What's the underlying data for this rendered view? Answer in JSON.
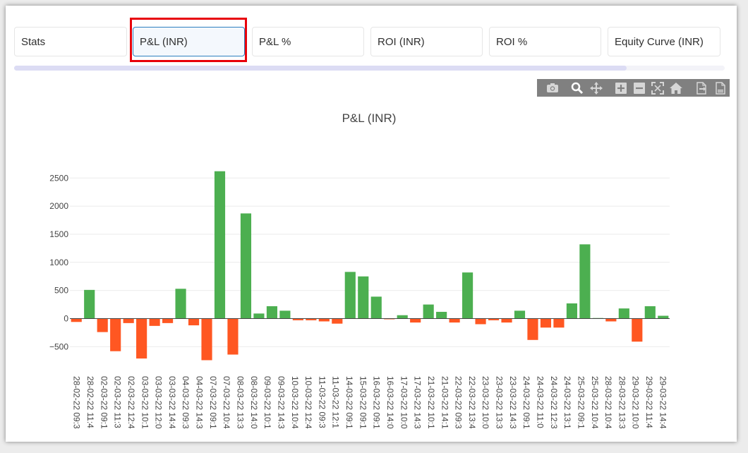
{
  "tabs": [
    {
      "label": "Stats",
      "active": false
    },
    {
      "label": "P&L (INR)",
      "active": true
    },
    {
      "label": "P&L %",
      "active": false
    },
    {
      "label": "ROI (INR)",
      "active": false
    },
    {
      "label": "ROI %",
      "active": false
    },
    {
      "label": "Equity Curve (INR)",
      "active": false
    }
  ],
  "modebar_icons": [
    "camera-icon",
    "zoom-icon",
    "pan-icon",
    "zoom-in-icon",
    "zoom-out-icon",
    "autoscale-icon",
    "home-icon",
    "download-csv-icon",
    "download-file-icon"
  ],
  "colors": {
    "positive": "#4caf50",
    "negative": "#ff5722",
    "active_tab_border": "#2d7fbf",
    "highlight": "#e8000b"
  },
  "chart_data": {
    "type": "bar",
    "title": "P&L (INR)",
    "xlabel": "",
    "ylabel": "",
    "ylim": [
      -750,
      2700
    ],
    "y_ticks": [
      2500,
      2000,
      1500,
      1000,
      500,
      0,
      -500
    ],
    "grid": true,
    "categories": [
      "28-02-22 09:3",
      "28-02-22 11:4",
      "02-03-22 09:1",
      "02-03-22 11:3",
      "02-03-22 12:4",
      "03-03-22 10:1",
      "03-03-22 12:0",
      "03-03-22 14:4",
      "04-03-22 09:3",
      "04-03-22 14:3",
      "07-03-22 09:1",
      "07-03-22 10:4",
      "08-03-22 13:3",
      "08-03-22 14:0",
      "09-03-22 10:1",
      "09-03-22 14:3",
      "10-03-22 10:4",
      "10-03-22 12:4",
      "11-03-22 09:3",
      "11-03-22 12:1",
      "14-03-22 09:1",
      "15-03-22 09:1",
      "16-03-22 09:1",
      "16-03-22 14:0",
      "17-03-22 10:0",
      "17-03-22 14:3",
      "21-03-22 10:1",
      "21-03-22 14:1",
      "22-03-22 09:3",
      "22-03-22 13:4",
      "23-03-22 10:0",
      "23-03-22 13:3",
      "23-03-22 14:3",
      "24-03-22 09:1",
      "24-03-22 11:0",
      "24-03-22 12:3",
      "24-03-22 13:1",
      "25-03-22 09:1",
      "25-03-22 10:4",
      "28-03-22 10:4",
      "28-03-22 13:3",
      "29-03-22 10:0",
      "29-03-22 11:4",
      "29-03-22 14:4"
    ],
    "values": [
      -60,
      510,
      -240,
      -580,
      -80,
      -710,
      -130,
      -80,
      530,
      -120,
      -740,
      2620,
      -640,
      1870,
      90,
      220,
      140,
      -30,
      -30,
      -50,
      -90,
      830,
      750,
      390,
      -10,
      60,
      -70,
      250,
      120,
      -70,
      820,
      -100,
      -30,
      -70,
      140,
      -380,
      -160,
      -160,
      270,
      1320,
      10,
      -50,
      180,
      -410,
      220,
      50
    ]
  }
}
